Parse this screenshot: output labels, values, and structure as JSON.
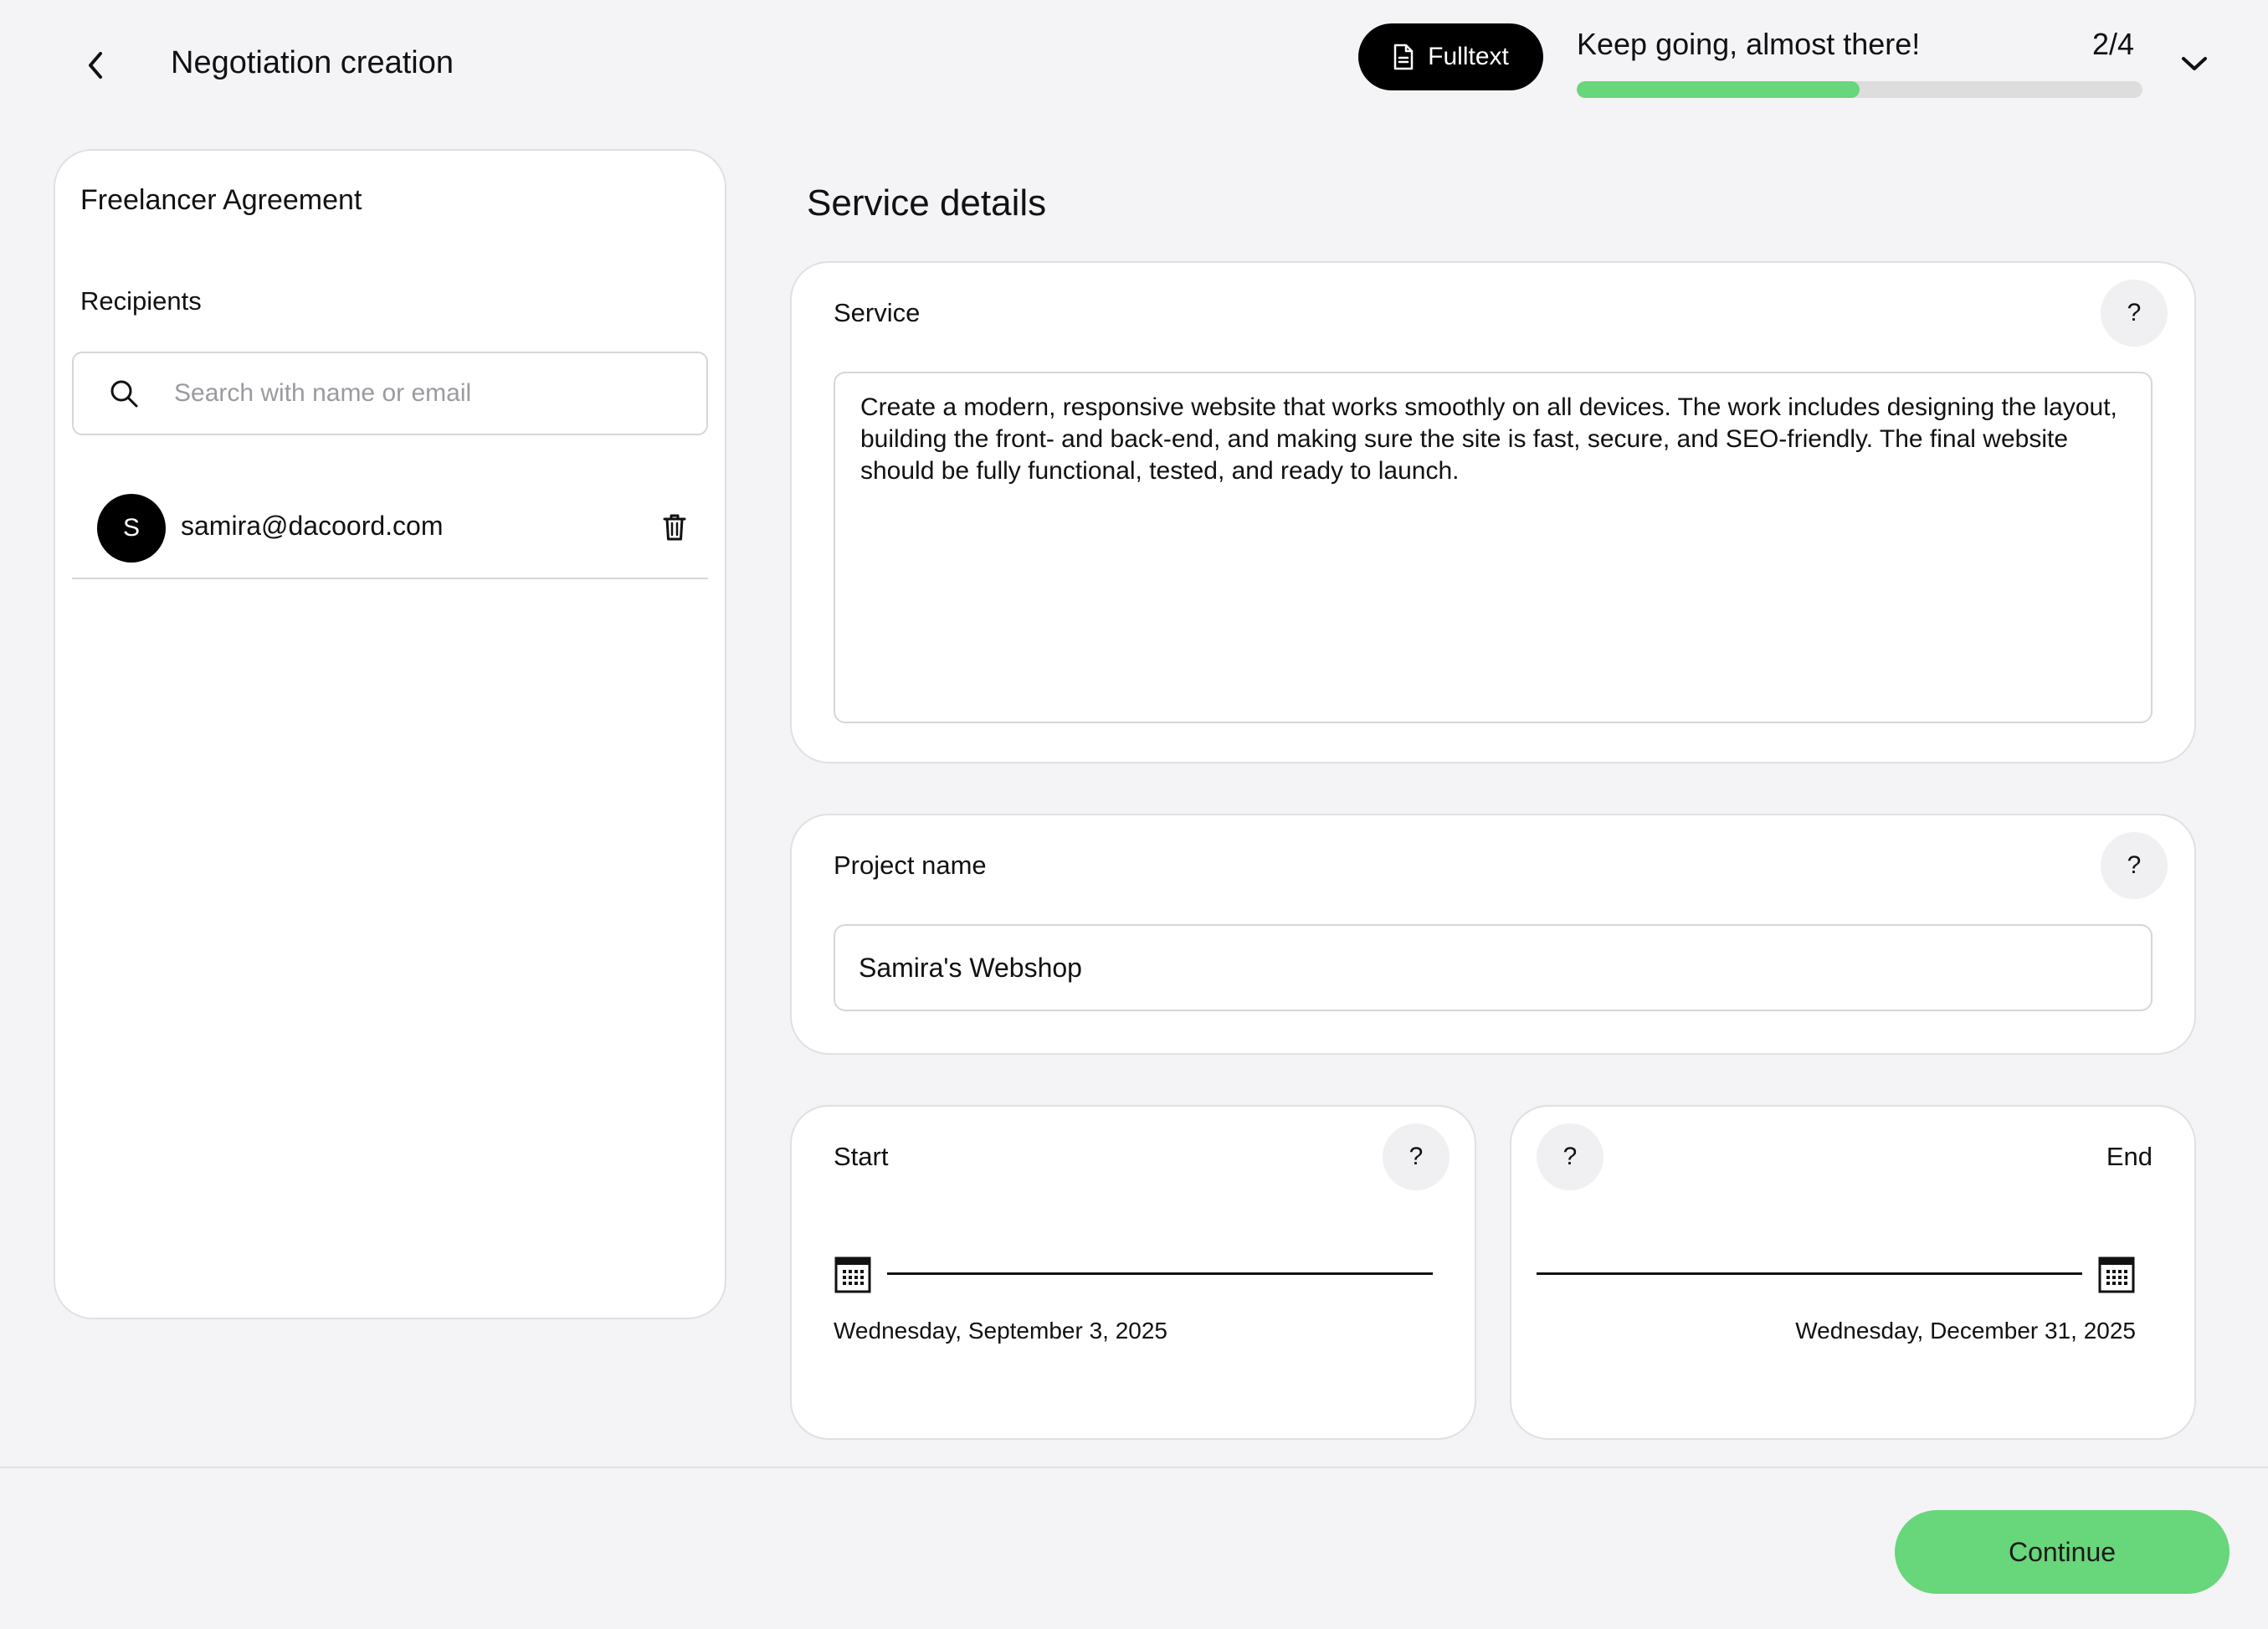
{
  "header": {
    "title": "Negotiation creation",
    "fulltext_label": "Fulltext",
    "progress_message": "Keep going, almost there!",
    "progress_count": "2/4",
    "progress_fraction": 0.5
  },
  "sidebar": {
    "agreement_title": "Freelancer Agreement",
    "recipients_label": "Recipients",
    "search_placeholder": "Search with name or email",
    "recipients": [
      {
        "initial": "S",
        "email": "samira@dacoord.com"
      }
    ]
  },
  "main": {
    "section_title": "Service details",
    "service": {
      "label": "Service",
      "help": "?",
      "value": "Create a modern, responsive website that works smoothly on all devices. The work includes designing the layout, building the front- and back-end, and making sure the site is fast, secure, and SEO-friendly. The final website should be fully functional, tested, and ready to launch."
    },
    "project_name": {
      "label": "Project name",
      "help": "?",
      "value": "Samira's Webshop"
    },
    "start": {
      "label": "Start",
      "help": "?",
      "date": "Wednesday, September 3, 2025"
    },
    "end": {
      "label": "End",
      "help": "?",
      "date": "Wednesday, December 31, 2025"
    }
  },
  "footer": {
    "continue_label": "Continue"
  },
  "icons": {
    "back": "chevron-left-icon",
    "fulltext": "document-icon",
    "collapse": "chevron-down-icon",
    "search": "search-icon",
    "delete": "trash-icon",
    "calendar": "calendar-icon"
  },
  "colors": {
    "accent": "#68d67a",
    "background": "#f4f4f6",
    "dark": "#000000"
  }
}
